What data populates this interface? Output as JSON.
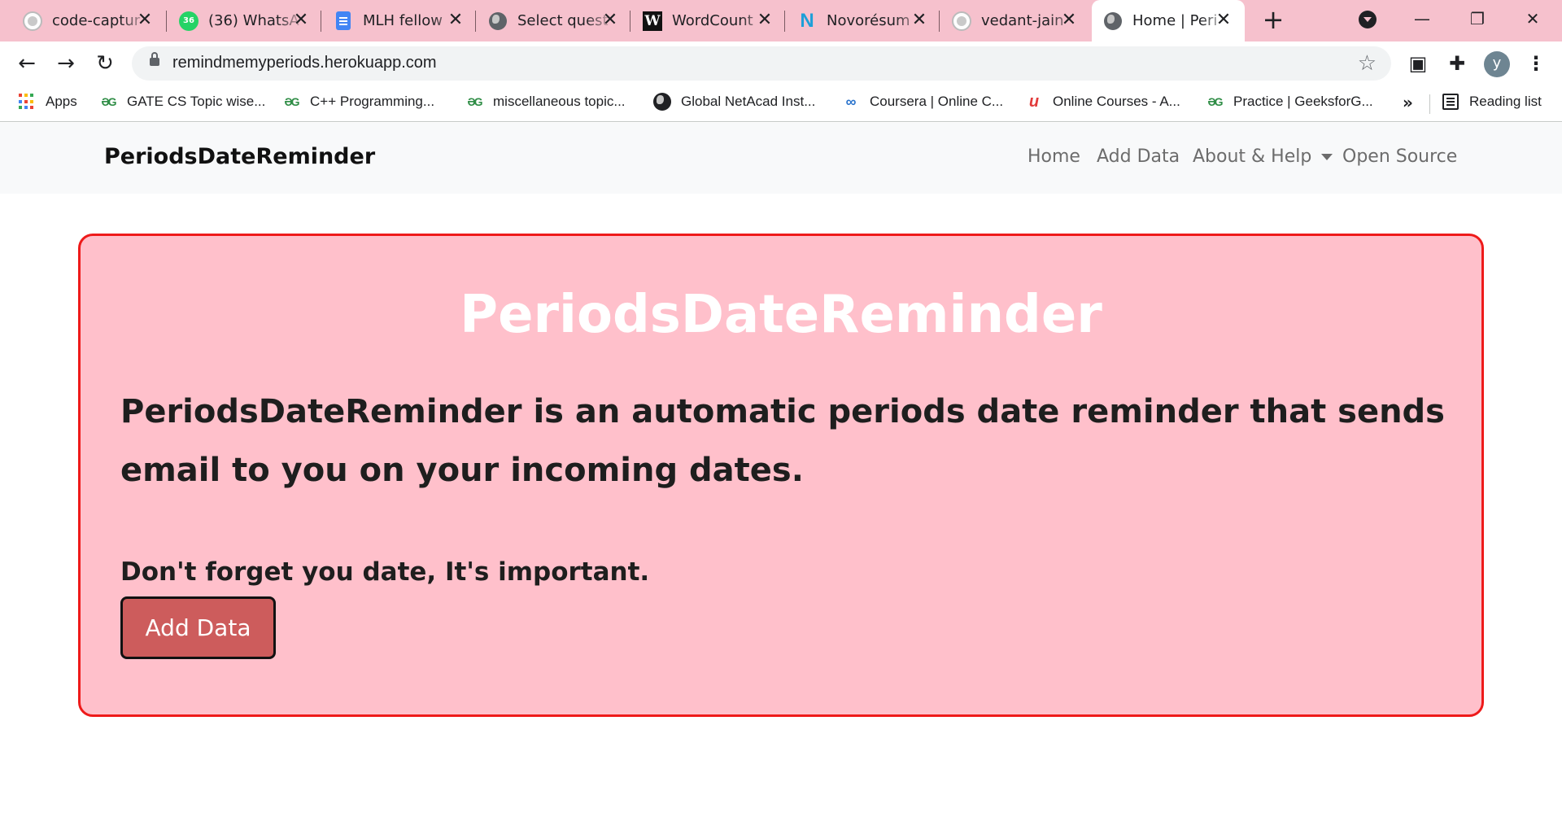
{
  "browser": {
    "tabs": [
      {
        "title": "code-captur",
        "icon": "github-icon"
      },
      {
        "title": "(36) WhatsA",
        "icon": "whatsapp-icon",
        "badge": "36"
      },
      {
        "title": "MLH fellow",
        "icon": "google-docs-icon"
      },
      {
        "title": "Select quest",
        "icon": "globe-icon"
      },
      {
        "title": "WordCount",
        "icon": "wordcounter-icon",
        "glyph": "W"
      },
      {
        "title": "Novorésum",
        "icon": "novoresume-icon",
        "glyph": "N"
      },
      {
        "title": "vedant-jain",
        "icon": "github-icon"
      },
      {
        "title": "Home | Peri",
        "icon": "globe-icon",
        "active": true
      }
    ],
    "tab_close_glyph": "✕",
    "new_tab_glyph": "+",
    "window_controls": {
      "minimize": "—",
      "restore": "❐",
      "close": "✕"
    },
    "nav": {
      "back": "←",
      "forward": "→",
      "reload": "↻"
    },
    "url": "remindmemyperiods.herokuapp.com",
    "star_glyph": "☆",
    "extension_glyphs": {
      "extension_a": "▣",
      "puzzle": "✚"
    },
    "profile_initial": "y",
    "menu_glyph": "⋮",
    "bookmarks": [
      {
        "label": "Apps",
        "icon": "apps-grid-icon"
      },
      {
        "label": "GATE CS Topic wise...",
        "icon": "geeksforgeeks-icon",
        "glyph": "ƏG"
      },
      {
        "label": "C++ Programming...",
        "icon": "geeksforgeeks-icon",
        "glyph": "ƏG"
      },
      {
        "label": "miscellaneous topic...",
        "icon": "geeksforgeeks-icon",
        "glyph": "ƏG"
      },
      {
        "label": "Global NetAcad Inst...",
        "icon": "globe-icon"
      },
      {
        "label": "Coursera | Online C...",
        "icon": "coursera-icon",
        "glyph": "∞"
      },
      {
        "label": "Online Courses - A...",
        "icon": "udemy-icon",
        "glyph": "u"
      },
      {
        "label": "Practice | GeeksforG...",
        "icon": "geeksforgeeks-icon",
        "glyph": "ƏG"
      }
    ],
    "bookmarks_overflow": "»",
    "reading_list": "Reading list",
    "colors": {
      "tabstrip": "#f6c1cd",
      "omnibox": "#f1f3f4"
    }
  },
  "site": {
    "brand": "PeriodsDateReminder",
    "nav_links": [
      "Home",
      "Add Data",
      "About & Help",
      "Open Source"
    ],
    "hero": {
      "title": "PeriodsDateReminder",
      "lead": "PeriodsDateReminder is an automatic periods date reminder that sends email to you on your incoming dates.",
      "note": "Don't forget you date, It's important.",
      "button": "Add Data"
    },
    "colors": {
      "card_bg": "#ffc0cb",
      "card_border": "#ee1a1a",
      "button_bg": "#cd5c5c",
      "navbar_bg": "#f8f9fa"
    }
  }
}
